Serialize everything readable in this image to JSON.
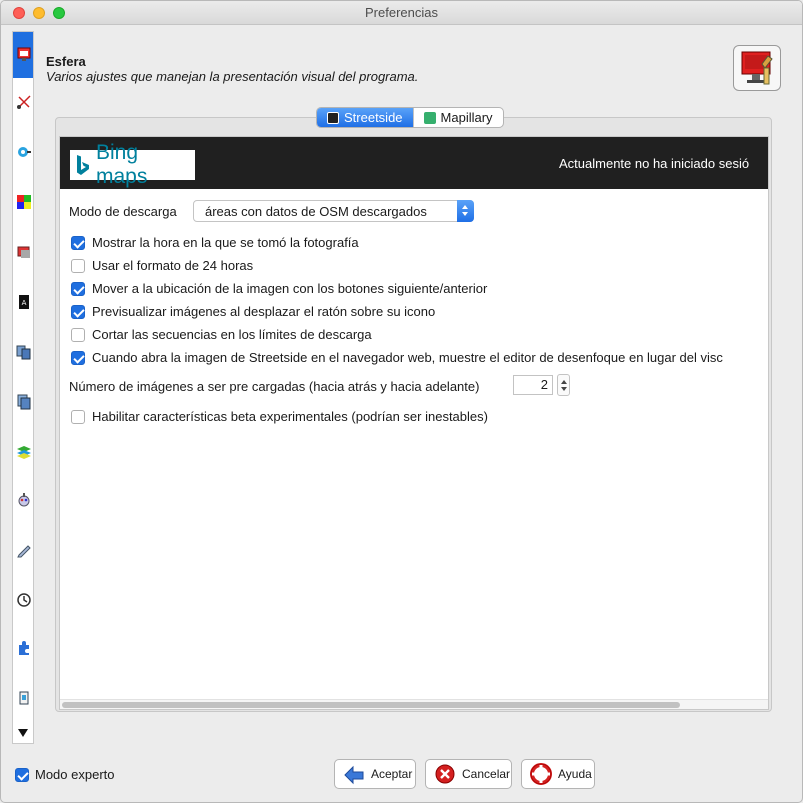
{
  "window": {
    "title": "Preferencias"
  },
  "header": {
    "title": "Esfera",
    "description": "Varios ajustes que manejan la presentación visual del programa."
  },
  "tabs": [
    {
      "label": "Streetside",
      "active": true
    },
    {
      "label": "Mapillary",
      "active": false
    }
  ],
  "banner": {
    "logo_text": "Bing maps",
    "login_status": "Actualmente no ha iniciado sesió"
  },
  "download_mode": {
    "label": "Modo de descarga",
    "selected": "áreas con datos de OSM descargados"
  },
  "options": [
    {
      "label": "Mostrar la hora en la que se tomó la fotografía",
      "checked": true
    },
    {
      "label": "Usar el formato de 24 horas",
      "checked": false
    },
    {
      "label": "Mover a la ubicación de la imagen con los botones siguiente/anterior",
      "checked": true
    },
    {
      "label": "Previsualizar imágenes al desplazar el ratón sobre su icono",
      "checked": true
    },
    {
      "label": "Cortar las secuencias en los límites de descarga",
      "checked": false
    },
    {
      "label": "Cuando abra la imagen de Streetside en el navegador web, muestre el editor de desenfoque en lugar del visc",
      "checked": true
    }
  ],
  "preload": {
    "label": "Número de imágenes a ser pre cargadas (hacia atrás y hacia adelante)",
    "value": "2"
  },
  "beta": {
    "label": "Habilitar características beta experimentales (podrían ser inestables)",
    "checked": false
  },
  "footer": {
    "expert_label": "Modo experto",
    "expert_checked": true,
    "accept": "Aceptar",
    "cancel": "Cancelar",
    "help": "Ayuda"
  },
  "colors": {
    "accent": "#1f6fe0",
    "banner_bg": "#202020",
    "bing_teal": "#00809d"
  }
}
